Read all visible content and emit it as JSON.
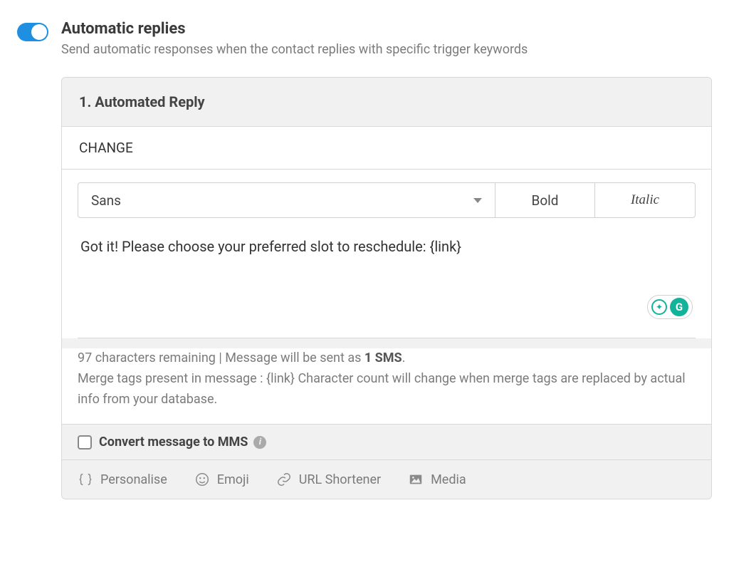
{
  "header": {
    "title": "Automatic replies",
    "subtitle": "Send automatic responses when the contact replies with specific trigger keywords",
    "toggle_on": true
  },
  "reply": {
    "section_title": "1. Automated Reply",
    "trigger_keyword": "CHANGE",
    "toolbar": {
      "font_selected": "Sans",
      "bold_label": "Bold",
      "italic_label": "Italic"
    },
    "message_body": "Got it! Please choose your preferred slot to reschedule: {link}",
    "meta": {
      "chars_remaining": "97 characters remaining",
      "separator": " | ",
      "sent_as_prefix": "Message will be sent as ",
      "sent_as_count": "1 SMS",
      "sent_as_suffix": ".",
      "merge_note": "Merge tags present in message : {link} Character count will change when merge tags are replaced by actual info from your database."
    },
    "mms": {
      "checked": false,
      "label": "Convert message to MMS"
    },
    "actions": {
      "personalise": "Personalise",
      "emoji": "Emoji",
      "url_shortener": "URL Shortener",
      "media": "Media"
    }
  }
}
